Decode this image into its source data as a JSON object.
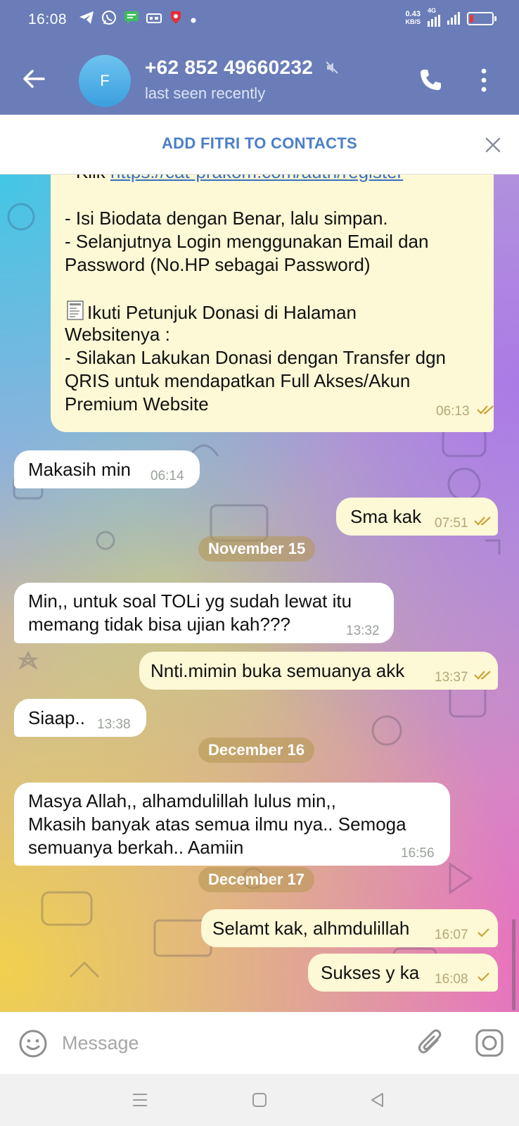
{
  "status_bar": {
    "time": "16:08",
    "net_speed_value": "0.43",
    "net_speed_unit": "KB/S",
    "network": "4G",
    "battery_level": 0.18,
    "battery_color": "#e53935",
    "notification_icons": [
      "telegram-icon",
      "whatsapp-icon",
      "chat-icon",
      "sim-icon",
      "app-icon",
      "dot-icon"
    ]
  },
  "header": {
    "avatar_letter": "F",
    "contact_name": "+62 852 49660232",
    "status": "last seen recently",
    "background": "#6a7db8"
  },
  "add_contact": {
    "label": "ADD FITRI TO CONTACTS"
  },
  "messages": {
    "m1": {
      "line1_prefix": "- Klik ",
      "link": "https://cat-prakom.com/auth/register",
      "line2": "- Isi Biodata dengan Benar, lalu simpan.",
      "line3": "- Selanjutnya Login menggunakan Email dan",
      "line4": "Password (No.HP sebagai Password)",
      "line5": "Ikuti Petunjuk Donasi di Halaman",
      "line6": "Websitenya :",
      "line7": "- Silakan Lakukan Donasi dengan Transfer dgn",
      "line8": "QRIS untuk mendapatkan Full Akses/Akun",
      "line9": "Premium Website",
      "time": "06:13"
    },
    "m2": {
      "text": "Makasih min",
      "time": "06:14"
    },
    "m3": {
      "text": "Sma kak",
      "time": "07:51"
    },
    "date1": "November 15",
    "m4": {
      "line1": "Min,,  untuk soal TOLi yg sudah lewat itu",
      "line2": "memang tidak bisa ujian kah???",
      "time": "13:32"
    },
    "m5": {
      "text": "Nnti.mimin buka semuanya akk",
      "time": "13:37"
    },
    "m6": {
      "text": "Siaap..",
      "time": "13:38"
    },
    "date2": "December 16",
    "m7": {
      "line1": "Masya Allah,,  alhamdulillah lulus min,,",
      "line2": "Mkasih banyak atas semua ilmu nya.. Semoga",
      "line3": "semuanya berkah.. Aamiin",
      "time": "16:56"
    },
    "date3": "December 17",
    "m8": {
      "text": "Selamt kak, alhmdulillah",
      "time": "16:07"
    },
    "m9": {
      "text": "Sukses y ka",
      "time": "16:08"
    }
  },
  "input": {
    "placeholder": "Message",
    "value": ""
  },
  "colors": {
    "incoming_bubble": "#ffffff",
    "outgoing_bubble": "#fdf8d5",
    "tick_color": "#c9a43a",
    "link_color": "#3a6fbf"
  }
}
